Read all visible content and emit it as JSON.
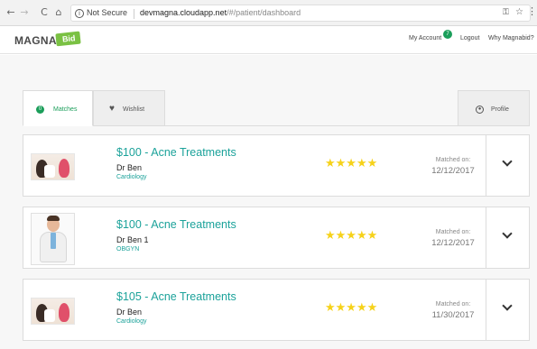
{
  "browser": {
    "back_icon": "←",
    "forward_icon": "→",
    "reload_icon": "C",
    "home_icon": "⌂",
    "security_label": "Not Secure",
    "url_host": "devmagna.cloudapp.net",
    "url_path": "/#/patient/dashboard"
  },
  "header": {
    "logo_text": "MAGNA",
    "logo_tag": "Bid",
    "my_account": "My Account",
    "account_badge": "7",
    "logout": "Logout",
    "why": "Why Magnabid?"
  },
  "tabs": {
    "matches": {
      "label": "Matches",
      "count": "0"
    },
    "wishlist": {
      "label": "Wishlist"
    },
    "profile": {
      "label": "Profile"
    }
  },
  "matches": [
    {
      "title": "$100 - Acne Treatments",
      "doctor": "Dr Ben",
      "specialty": "Cardiology",
      "stars": "★★★★★",
      "matched_label": "Matched on:",
      "matched_date": "12/12/2017",
      "thumb": "consultation"
    },
    {
      "title": "$100 - Acne Treatments",
      "doctor": "Dr Ben 1",
      "specialty": "OBGYN",
      "stars": "★★★★★",
      "matched_label": "Matched on:",
      "matched_date": "12/12/2017",
      "thumb": "doctor"
    },
    {
      "title": "$105 - Acne Treatments",
      "doctor": "Dr Ben",
      "specialty": "Cardiology",
      "stars": "★★★★★",
      "matched_label": "Matched on:",
      "matched_date": "11/30/2017",
      "thumb": "consultation"
    }
  ],
  "colors": {
    "accent_teal": "#1ba29a",
    "brand_green": "#7ac143",
    "badge_green": "#1b9e5a",
    "star_yellow": "#f6d21a"
  }
}
